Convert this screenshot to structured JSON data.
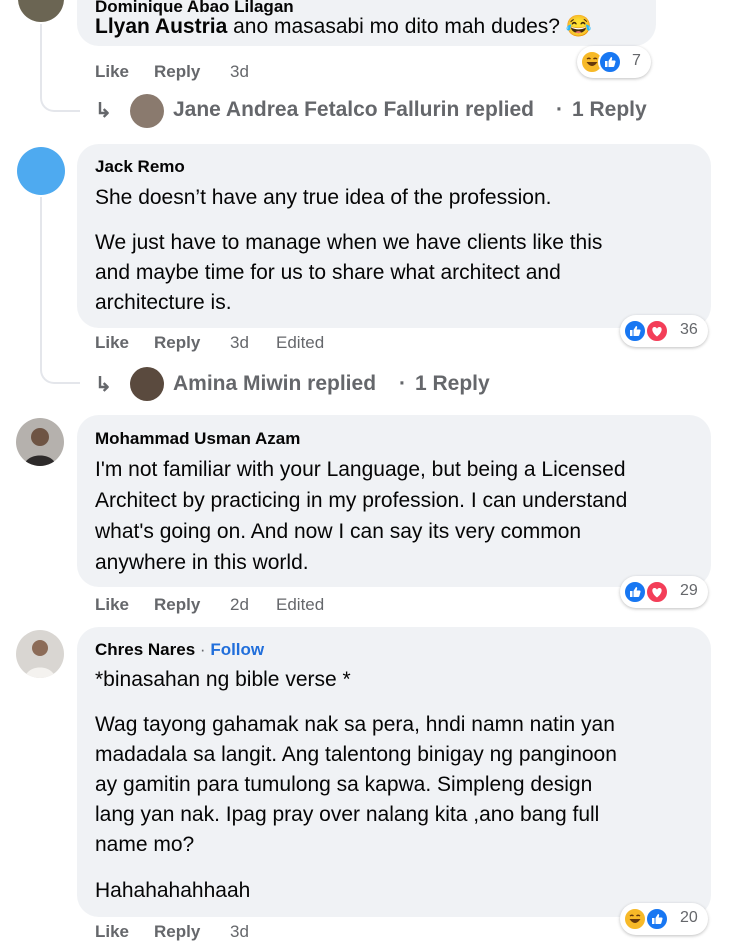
{
  "colors": {
    "bubble": "#f0f2f5",
    "meta_text": "#65676b",
    "like_blue": "#1877f2",
    "love_red": "#f33e58",
    "haha_yellow": "#f7b928",
    "link_blue": "#216fdb"
  },
  "comments": [
    {
      "author": "Dominique Abao Lilagan",
      "text_lines": [
        "Llyan Austria ano masasabi mo dito mah dudes? 😂"
      ],
      "mention": "Llyan Austria",
      "actions": {
        "like": "Like",
        "reply": "Reply",
        "time": "3d"
      },
      "reactions": {
        "icons": [
          "haha-icon",
          "like-icon"
        ],
        "count": "7"
      },
      "replies": {
        "name": "Jane Andrea Fetalco Fallurin replied",
        "sep": "·",
        "count": "1 Reply"
      }
    },
    {
      "author": "Jack Remo",
      "paragraphs": [
        [
          "She doesn’t have any true idea of the profession."
        ],
        [
          "We just have to manage when we have clients like this",
          "and maybe time for us to share what architect and",
          "architecture is."
        ]
      ],
      "actions": {
        "like": "Like",
        "reply": "Reply",
        "time": "3d",
        "edited": "Edited"
      },
      "reactions": {
        "icons": [
          "like-icon",
          "love-icon"
        ],
        "count": "36"
      },
      "replies": {
        "name": "Amina Miwin replied",
        "sep": "·",
        "count": "1 Reply"
      }
    },
    {
      "author": "Mohammad Usman Azam",
      "paragraphs": [
        [
          "I'm not familiar with your Language, but being a Licensed",
          "Architect by practicing in my profession. I can understand",
          "what's going on. And now I can say its very common",
          "anywhere in this world."
        ]
      ],
      "actions": {
        "like": "Like",
        "reply": "Reply",
        "time": "2d",
        "edited": "Edited"
      },
      "reactions": {
        "icons": [
          "like-icon",
          "love-icon"
        ],
        "count": "29"
      }
    },
    {
      "author": "Chres Nares",
      "follow": "Follow",
      "follow_sep": "·",
      "paragraphs": [
        [
          "*binasahan ng bible verse *"
        ],
        [
          "Wag tayong gahamak nak sa pera, hndi namn natin yan",
          "madadala sa langit. Ang talentong binigay ng panginoon",
          "ay gamitin para tumulong sa kapwa. Simpleng design",
          "lang yan nak. Ipag pray over nalang kita ,ano bang full",
          "name mo?"
        ],
        [
          "Hahahahahhaah"
        ]
      ],
      "actions": {
        "like": "Like",
        "reply": "Reply",
        "time": "3d"
      },
      "reactions": {
        "icons": [
          "haha-icon",
          "like-icon"
        ],
        "count": "20"
      }
    }
  ]
}
